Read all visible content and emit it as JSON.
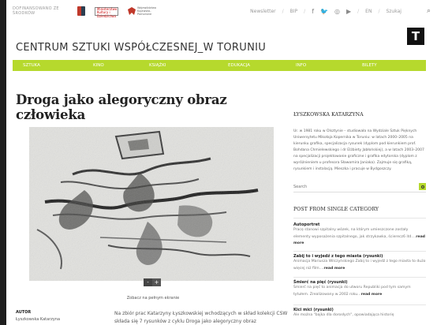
{
  "topbar": {
    "cofinance_text": "DOFINANSOWANO ZE ŚRODKÓW",
    "logo_kultura_text": "Ministerstwo Kultury i Dziedzictwa",
    "logo_region_text": "Województwo Kujawsko-Pomorskie",
    "newsletter": "Newsletter",
    "bip": "BIP",
    "lang_en": "EN",
    "search": "Szukaj"
  },
  "site": {
    "title": "CENTRUM SZTUKI WSPÓŁCZESNEJ_W TORUNIU"
  },
  "menu": [
    "SZTUKA",
    "KINO",
    "KSIĄŻKI",
    "EDUKACJA",
    "INFO",
    "BILETY"
  ],
  "article": {
    "title": "Droga jako alegoryczny obraz człowieka",
    "view_full": "Zobacz na pełnym ekranie",
    "zoom_out": "-",
    "zoom_in": "+",
    "author_label": "AUTOR",
    "author_name": "Łyszkowska Katarzyna",
    "body_text": "Na zbiór prac Katarzyny Łyszkowskiej wchodzących w skład kolekcji CSW składa się 7 rysunków z cyklu Droga jako alegoryczny obraz"
  },
  "sidebar": {
    "author_heading": "ŁYSZKOWSKA KATARZYNA",
    "bio": "Ur. w 1981 roku w Olsztynie – studiowała na Wydziale Sztuk Pięknych Uniwersytetu Mikołaja Kopernika w Toruniu: w latach 2000–2005 na kierunku grafika, specjalizacja rysunek (dyplom pod kierunkiem prof. Bohdana Chmielewskiego i dr Elżbiety Jabłońskiej), a w latach 2003–2007 na specjalizacji projektowanie graficzne i grafika edytorska (dyplom z wyróżnieniem u profesora Sławomira Janiaka). Zajmuje się grafiką, rysunkiem i instalacją. Mieszka i pracuje w Bydgoszczy.",
    "search_placeholder": "Search",
    "posts_heading": "POST FROM SINGLE CATEGORY",
    "posts": [
      {
        "title": "Autoportret",
        "desc": "Pracę stanowi szpitalny wózek, na którym umieszczone zostały elementy wyposażenia szpitalnego, jak strzykawka, ścierecz6 itd....",
        "more": "read more"
      },
      {
        "title": "Zabij to i wyjedź z tego miasta (rysunki)",
        "desc": "Animacja Mariusza Wilczyńskiego Zabij to i wyjedź z tego miasta to dużo więcej niż film....",
        "more": "read more"
      },
      {
        "title": "Śmierć na pięć (rysunki)",
        "desc": "Śmierć na pięć to animacja do utworu Republiki pod tym samym tytułem. Zrealizowany w 2002 roku...",
        "more": "read more"
      },
      {
        "title": "Kici mici (rysunki)",
        "desc": "Ale można \"bajka dla dorosłych\", opowiadająca historię",
        "more": ""
      }
    ]
  },
  "colors": {
    "accent_green": "#b6d92d",
    "text_dark": "#222222"
  }
}
